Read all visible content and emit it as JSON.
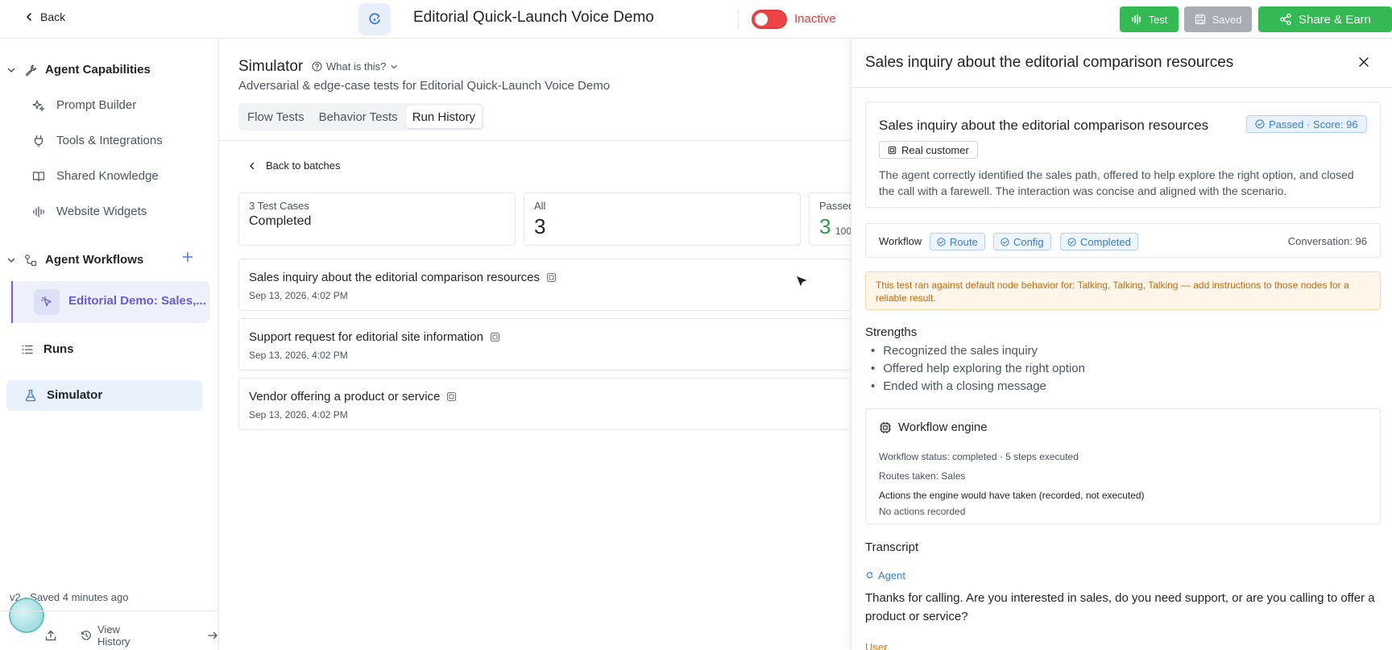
{
  "topbar": {
    "back_label": "Back",
    "title": "Editorial Quick-Launch Voice Demo",
    "status": "Inactive",
    "test_label": "Test",
    "saved_label": "Saved",
    "share_label": "Share & Earn"
  },
  "sidebar": {
    "capabilities_title": "Agent Capabilities",
    "capabilities": [
      {
        "label": "Prompt Builder"
      },
      {
        "label": "Tools & Integrations"
      },
      {
        "label": "Shared Knowledge"
      },
      {
        "label": "Website Widgets"
      }
    ],
    "workflows_title": "Agent Workflows",
    "active_workflow": "Editorial Demo: Sales,...",
    "runs_label": "Runs",
    "simulator_label": "Simulator",
    "footer_saved": "v2 · Saved 4 minutes ago",
    "view_history": "View History"
  },
  "main": {
    "title": "Simulator",
    "what_is": "What is this?",
    "subtitle": "Adversarial & edge-case tests for Editorial Quick-Launch Voice Demo",
    "tabs": [
      {
        "label": "Flow Tests"
      },
      {
        "label": "Behavior Tests"
      },
      {
        "label": "Run History"
      }
    ],
    "back_to_batches": "Back to batches",
    "stats": {
      "batch_label": "3 Test Cases",
      "batch_value": "Completed",
      "all_label": "All",
      "all_value": "3",
      "passed_label": "Passed",
      "passed_value": "3",
      "passed_pct": "100"
    },
    "cases": [
      {
        "title": "Sales inquiry about the editorial comparison resources",
        "date": "Sep 13, 2026, 4:02 PM"
      },
      {
        "title": "Support request for editorial site information",
        "date": "Sep 13, 2026, 4:02 PM"
      },
      {
        "title": "Vendor offering a product or service",
        "date": "Sep 13, 2026, 4:02 PM"
      }
    ]
  },
  "panel": {
    "title": "Sales inquiry about the editorial comparison resources",
    "result_title": "Sales inquiry about the editorial comparison resources",
    "passed_badge": "Passed · Score: 96",
    "customer_badge": "Real customer",
    "result_desc": "The agent correctly identified the sales path, offered to help explore the right option, and closed the call with a farewell. The interaction was concise and aligned with the scenario.",
    "workflow_label": "Workflow",
    "workflow_chips": [
      "Route",
      "Config",
      "Completed"
    ],
    "conversation_score": "Conversation: 96",
    "warning": "This test ran against default node behavior for: Talking, Talking, Talking — add instructions to those nodes for a reliable result.",
    "strengths_title": "Strengths",
    "strengths": [
      "Recognized the sales inquiry",
      "Offered help exploring the right option",
      "Ended with a closing message"
    ],
    "engine_title": "Workflow engine",
    "engine_status": "Workflow status: completed · 5 steps executed",
    "engine_routes": "Routes taken: Sales",
    "engine_actions_title": "Actions the engine would have taken (recorded, not executed)",
    "engine_actions": "No actions recorded",
    "transcript_title": "Transcript",
    "agent_label": "Agent",
    "agent_message": "Thanks for calling. Are you interested in sales, do you need support, or are you calling to offer a product or service?",
    "user_label": "User"
  },
  "colors": {
    "accent_green": "#34b955",
    "accent_blue": "#3e7dc9",
    "inactive_red": "#dc3f3f",
    "workflow_purple": "#6c5ad2",
    "warning_orange": "#c76b12"
  }
}
